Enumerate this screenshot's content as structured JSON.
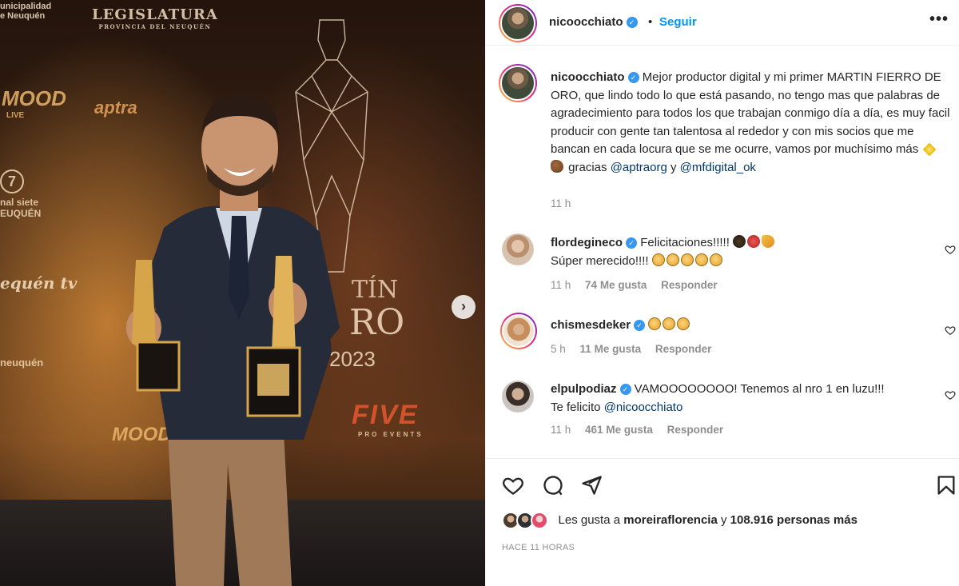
{
  "photo": {
    "sponsors": {
      "municipalidad": "unicipalidad\ne Neuquén",
      "legislatura": "LEGISLATURA",
      "legislatura_sub": "PROVINCIA DEL NEUQUÉN",
      "mood": "MOOD",
      "mood_sub": "LIVE",
      "aptra": "aptra",
      "canal_seven": "7",
      "canal": "nal siete\nEUQUÉN",
      "neuquen_tv": "equén tv",
      "neuquen_capital": "neuquén",
      "five": "FIVE",
      "five_sub": "PRO EVENTS",
      "martin": "TÍN",
      "fierro": "RO",
      "year": "2023"
    },
    "next_icon": "chevron-right-icon"
  },
  "header": {
    "username": "nicoocchiato",
    "separator": "•",
    "follow_label": "Seguir",
    "more_icon": "•••"
  },
  "caption": {
    "username": "nicoocchiato",
    "text_1": "Mejor productor digital y mi primer MARTIN FIERRO DE ORO, que lindo todo lo que está pasando, no tengo mas que palabras de agradecimiento para todos los que trabajan conmigo día a día, es muy facil producir con gente tan talentosa al rededor y con mis socios que me bancan en cada locura que se me ocurre, vamos por muchísimo más",
    "text_2": "gracias",
    "mention_1": "@aptraorg",
    "connector": "y",
    "mention_2": "@mfdigital_ok",
    "time": "11 h"
  },
  "comments": [
    {
      "username": "flordegineco",
      "text_1": "Felicitaciones!!!!!",
      "text_2": "Súper merecido!!!!",
      "time": "11 h",
      "likes": "74 Me gusta",
      "reply": "Responder"
    },
    {
      "username": "chismesdeker",
      "text_1": "",
      "time": "5 h",
      "likes": "11 Me gusta",
      "reply": "Responder"
    },
    {
      "username": "elpulpodiaz",
      "text_1": "VAMOOOOOOOO! Tenemos al nro 1 en luzu!!!",
      "text_2": "Te felicito",
      "mention": "@nicoocchiato",
      "time": "11 h",
      "likes": "461 Me gusta",
      "reply": "Responder"
    }
  ],
  "actions": {
    "like_icon": "heart-icon",
    "comment_icon": "comment-icon",
    "share_icon": "send-icon",
    "save_icon": "bookmark-icon"
  },
  "likes": {
    "prefix": "Les gusta a",
    "user": "moreiraflorencia",
    "connector": "y",
    "count": "108.916 personas más"
  },
  "posted": "HACE 11 HORAS",
  "colors": {
    "link_blue": "#0095f6",
    "verified_blue": "#3897f0",
    "mention": "#00376b",
    "muted": "#8e8e8e"
  }
}
